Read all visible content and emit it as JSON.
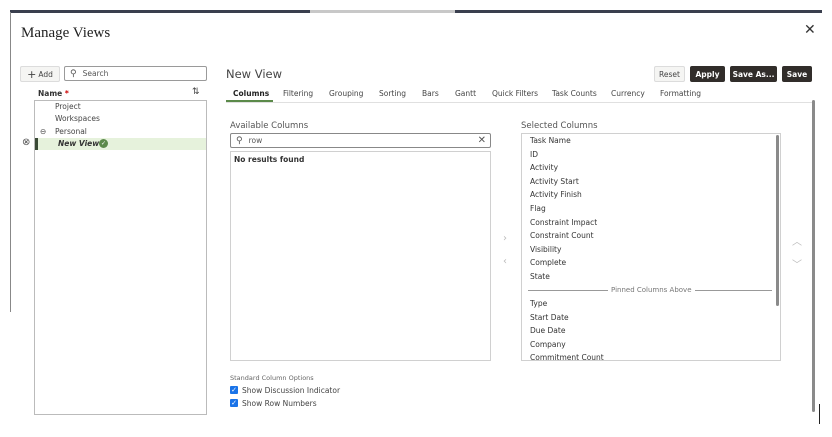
{
  "dialog": {
    "title": "Manage Views",
    "close_icon": "close-icon"
  },
  "sidebar": {
    "add_label": "Add",
    "search_placeholder": "Search",
    "name_header": "Name",
    "required_mark": "*",
    "tree": [
      {
        "label": "Project"
      },
      {
        "label": "Workspaces"
      },
      {
        "label": "Personal",
        "expanded": true
      },
      {
        "label": "New View",
        "selected": true,
        "status": "check-circle-icon"
      }
    ]
  },
  "header": {
    "view_name": "New View",
    "buttons": {
      "reset": "Reset",
      "apply": "Apply",
      "save_as": "Save As...",
      "save": "Save"
    }
  },
  "tabs": [
    {
      "label": "Columns",
      "active": true
    },
    {
      "label": "Filtering"
    },
    {
      "label": "Grouping"
    },
    {
      "label": "Sorting"
    },
    {
      "label": "Bars"
    },
    {
      "label": "Gantt"
    },
    {
      "label": "Quick Filters"
    },
    {
      "label": "Task Counts"
    },
    {
      "label": "Currency"
    },
    {
      "label": "Formatting"
    }
  ],
  "available": {
    "label": "Available Columns",
    "search_value": "row",
    "empty_text": "No results found"
  },
  "selected": {
    "label": "Selected Columns",
    "pinned": [
      "Task Name",
      "ID",
      "Activity",
      "Activity Start",
      "Activity Finish",
      "Flag",
      "Constraint Impact",
      "Constraint Count",
      "Visibility",
      "Complete",
      "State"
    ],
    "divider": "Pinned Columns Above",
    "others": [
      "Type",
      "Start Date",
      "Due Date",
      "Company",
      "Commitment Count"
    ]
  },
  "options": {
    "title": "Standard Column Options",
    "items": [
      {
        "label": "Show Discussion Indicator",
        "checked": true
      },
      {
        "label": "Show Row Numbers",
        "checked": true
      }
    ]
  },
  "colors": {
    "accent": "#5b8a4a",
    "selected_row": "#e6f2dc",
    "dark_button": "#312d2a",
    "checkbox": "#1a73e8"
  }
}
